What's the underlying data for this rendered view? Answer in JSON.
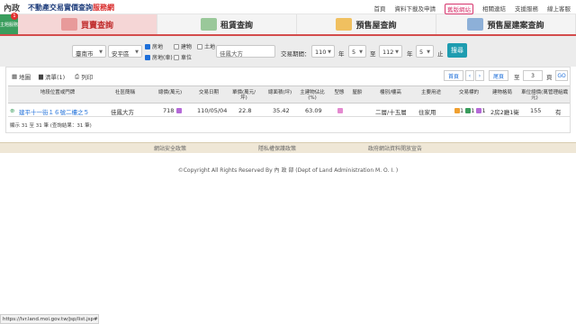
{
  "header": {
    "logo_text": "內政部",
    "title_main": "不動產交易實價查詢",
    "title_accent": "服務網",
    "links": [
      "首頁",
      "資料下載及申請",
      "舊版網站",
      "相關連結",
      "支援服務",
      "線上客服"
    ]
  },
  "tabs": {
    "side_label": "主題服務",
    "badge": "1",
    "items": [
      "買賣查詢",
      "租賃查詢",
      "預售屋查詢",
      "預售屋建案查詢"
    ]
  },
  "filters": {
    "city": "臺南市",
    "district": "安平區",
    "checkbox_labels": [
      "房地",
      "房地(車)",
      "建物",
      "車位",
      "土地"
    ],
    "keyword_placeholder": "佳鳳大方",
    "period_label": "交易期間：",
    "from_year": "110",
    "year_unit": "年",
    "from_month": "5",
    "to_label": "至",
    "to_year": "112",
    "to_month": "5",
    "end_label": "止",
    "search_label": "搜尋"
  },
  "results": {
    "toolbar": {
      "map": "地圖",
      "list": "清單(1)",
      "print": "列印"
    },
    "pager": {
      "first": "首頁",
      "prev": "‹",
      "next": "›",
      "last": "尾頁",
      "to": "至",
      "page_value": "3",
      "page_unit": "頁",
      "go": "GO"
    },
    "headers": [
      "地段位置或門牌",
      "社區簡稱",
      "總價(萬元)",
      "交易日期",
      "單價(萬元/坪)",
      "總面積(坪)",
      "主建物佔比(%)",
      "型態",
      "屋齡",
      "樓別/樓高",
      "主要用途",
      "交易標的",
      "建物格局",
      "車位總價(萬元)",
      "管理組織"
    ],
    "row": {
      "address": "建平十一街１６號二樓之５",
      "community": "佳鳳大方",
      "total_price": "718",
      "date": "110/05/04",
      "unit_price": "22.8",
      "area": "35.42",
      "main_ratio": "63.09",
      "floor": "二層/十五層",
      "use": "住家用",
      "target_a": "1",
      "target_b": "1",
      "target_c": "1",
      "layout": "2房2廳1衛",
      "parking_price": "155",
      "management": "有"
    },
    "summary": "顯示 31 至 31 筆 (查詢結果：31 筆)"
  },
  "footer": {
    "links": [
      "網站安全政策",
      "隱私權保護政策",
      "政府網站資料開放宣告"
    ],
    "copyright": "©Copyright All Rights Reserved By 內 政 部 (Dept of Land Administration M. O. I. )"
  },
  "statusbar": {
    "url": "https://lvr.land.moi.gov.tw/jsp/list.jsp#"
  },
  "colors": {
    "accent": "#d34c4c",
    "link": "#1e6fd9",
    "search": "#1e9cb0"
  }
}
